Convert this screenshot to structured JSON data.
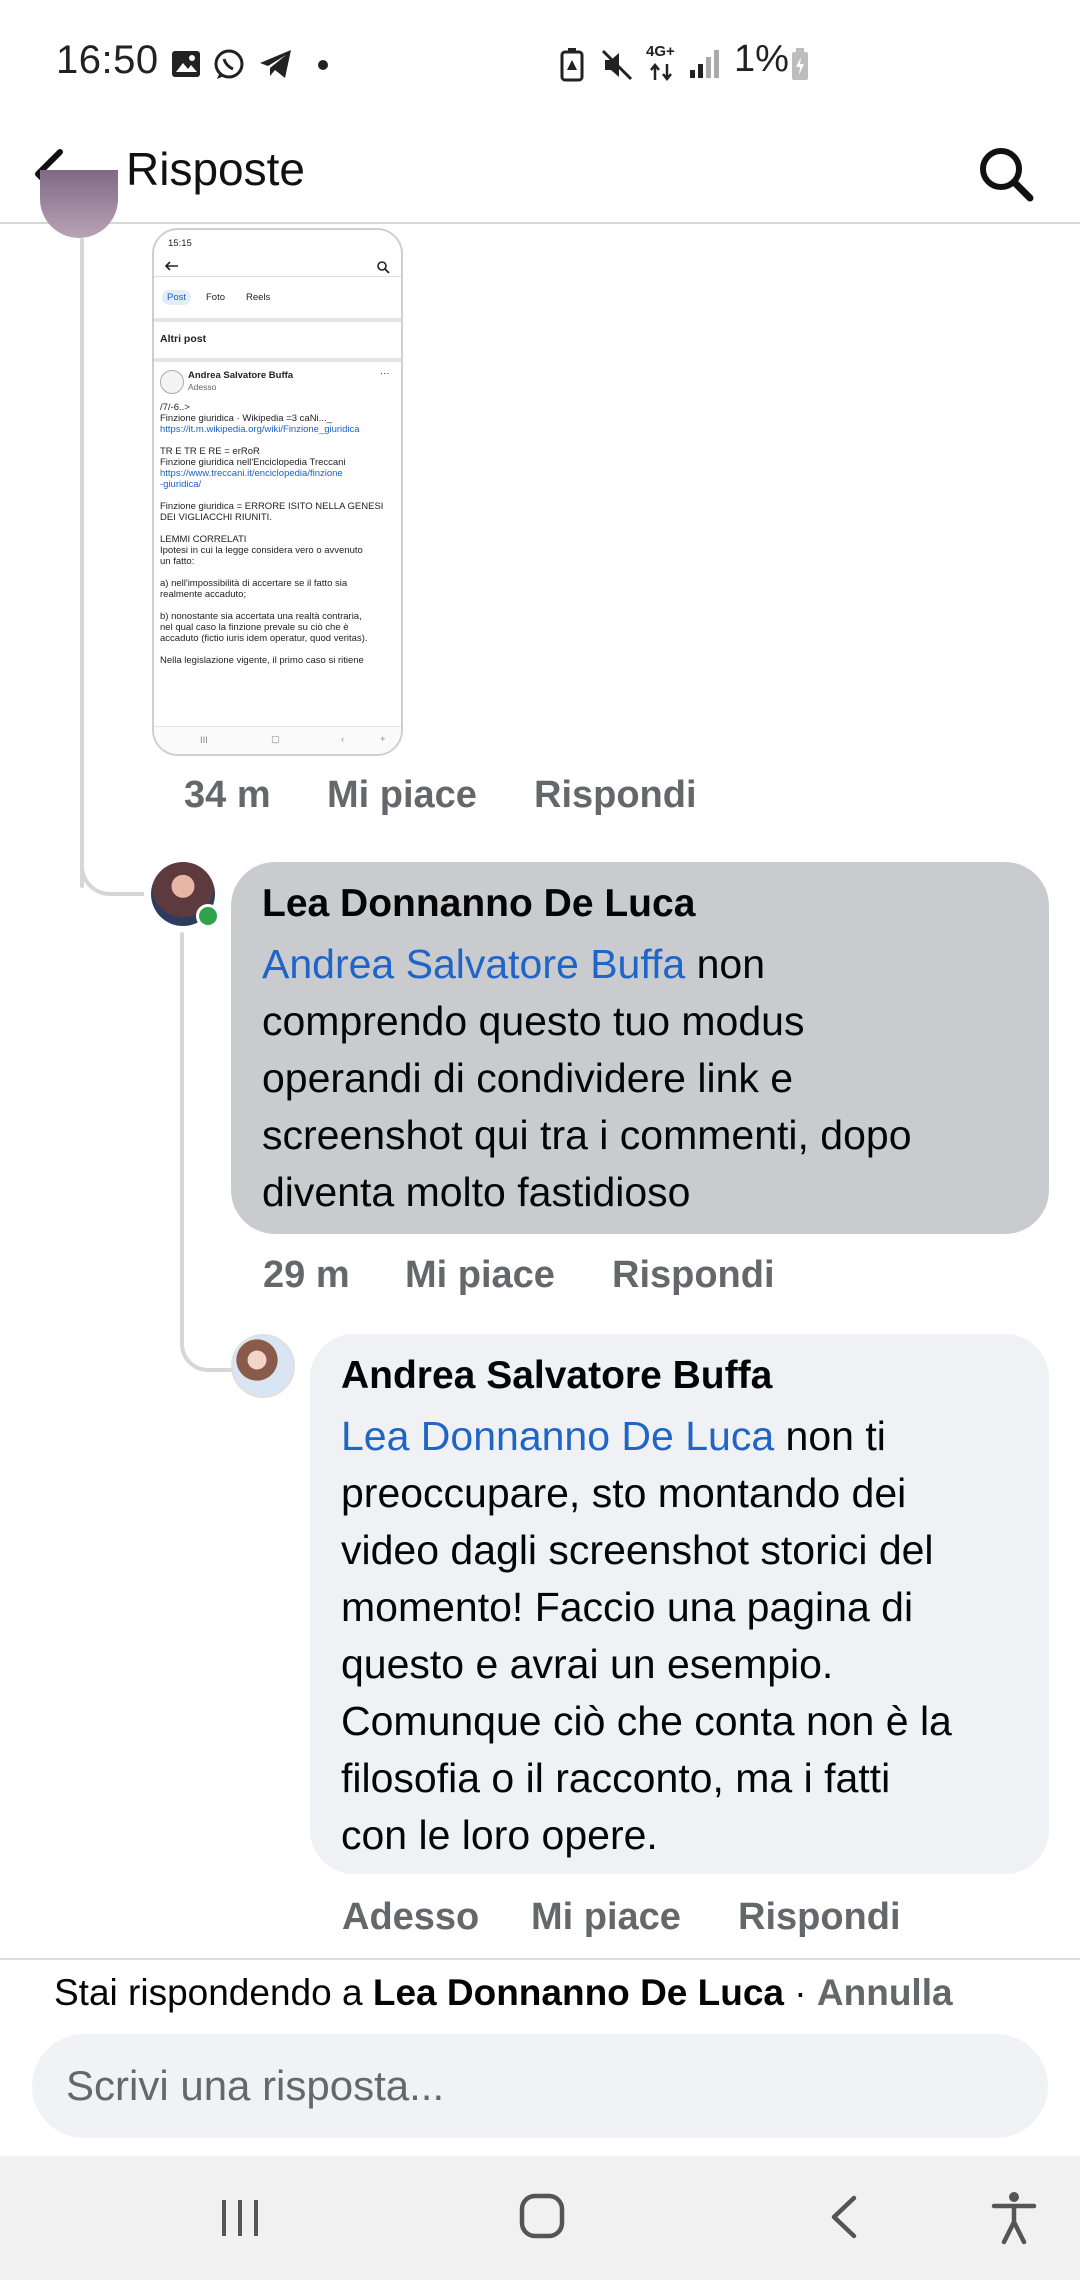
{
  "status_bar": {
    "time": "16:50",
    "notification_icons": [
      "image-icon",
      "whatsapp-icon",
      "telegram-icon",
      "dot-icon"
    ],
    "network": "4G+",
    "battery": "1%",
    "system_icons": [
      "battery-saver-icon",
      "mute-icon",
      "network-icon",
      "signal-icon",
      "battery-icon"
    ]
  },
  "header": {
    "title": "Risposte",
    "back_icon": "arrow-left-icon",
    "search_icon": "search-icon"
  },
  "screenshot": {
    "time": "15:15",
    "tabs": [
      "Post",
      "Foto",
      "Reels"
    ],
    "section": "Altri post",
    "post_author": "Andrea Salvatore Buffa",
    "post_time": "Adesso",
    "lines": [
      "/7/-6..>",
      "Finzione giuridica · Wikipedia =3 caNi..._",
      "https://it.m.wikipedia.org/wiki/Finzione_giuridica",
      "",
      "TR E TR E RE = erRoR",
      "Finzione giuridica nell'Enciclopedia Treccani",
      "https://www.treccani.it/enciclopedia/finzione",
      "-giuridica/",
      "",
      "Finzione giuridica = ERRORE ISITO NELLA GENESI",
      "DEI VIGLIACCHI RIUNITI.",
      "",
      "LEMMI CORRELATI",
      "Ipotesi in cui la legge considera vero o avvenuto",
      "un fatto:",
      "",
      "a) nell'impossibilità di accertare se il fatto sia",
      "realmente accaduto;",
      "",
      "b) nonostante sia accertata una realtà contraria,",
      "nel qual caso la finzione prevale su ciò che è",
      "accaduto (fictio iuris idem operatur, quod veritas).",
      "",
      "Nella legislazione vigente, il primo caso si ritiene"
    ]
  },
  "comments": [
    {
      "time": "34 m",
      "like_label": "Mi piace",
      "reply_label": "Rispondi"
    },
    {
      "author": "Lea Donnanno De Luca",
      "mention": "Andrea Salvatore Buffa",
      "text_first": "non",
      "text_lines": [
        "comprendo questo tuo modus",
        "operandi di condividere link e",
        "screenshot qui tra i commenti, dopo",
        "diventa molto fastidioso"
      ],
      "time": "29 m",
      "like_label": "Mi piace",
      "reply_label": "Rispondi"
    },
    {
      "author": "Andrea Salvatore Buffa",
      "mention": "Lea Donnanno De Luca",
      "text_first": "non ti",
      "text_lines": [
        "preoccupare, sto montando dei",
        "video dagli screenshot storici del",
        "momento! Faccio una pagina di",
        "questo e avrai un esempio.",
        "Comunque ciò che conta non è la",
        "filosofia o il racconto, ma i fatti",
        "con le loro opere."
      ],
      "time": "Adesso",
      "like_label": "Mi piace",
      "reply_label": "Rispondi"
    }
  ],
  "reply_bar": {
    "prefix": "Stai rispondendo a",
    "target": "Lea Donnanno De Luca",
    "separator": "·",
    "cancel_label": "Annulla",
    "placeholder": "Scrivi una risposta..."
  },
  "nav_bar": {
    "icons": [
      "recent-apps-icon",
      "home-icon",
      "back-icon",
      "accessibility-icon"
    ]
  },
  "colors": {
    "mention": "#1f64c7",
    "bubble_selected": "#c9cbcf",
    "bubble": "#eff1f4",
    "meta": "#65676b",
    "online": "#31a24c"
  }
}
